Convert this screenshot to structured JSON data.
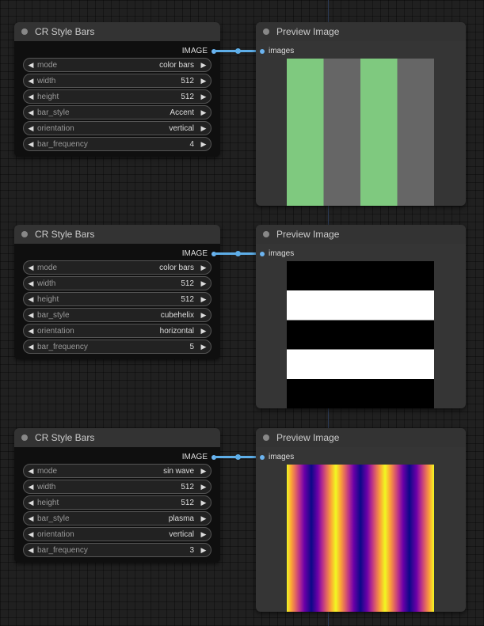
{
  "nodes": [
    {
      "title": "CR Style Bars",
      "output_label": "IMAGE",
      "widgets": [
        {
          "label": "mode",
          "value": "color bars"
        },
        {
          "label": "width",
          "value": "512"
        },
        {
          "label": "height",
          "value": "512"
        },
        {
          "label": "bar_style",
          "value": "Accent"
        },
        {
          "label": "orientation",
          "value": "vertical"
        },
        {
          "label": "bar_frequency",
          "value": "4"
        }
      ],
      "preview_title": "Preview Image",
      "input_label": "images"
    },
    {
      "title": "CR Style Bars",
      "output_label": "IMAGE",
      "widgets": [
        {
          "label": "mode",
          "value": "color bars"
        },
        {
          "label": "width",
          "value": "512"
        },
        {
          "label": "height",
          "value": "512"
        },
        {
          "label": "bar_style",
          "value": "cubehelix"
        },
        {
          "label": "orientation",
          "value": "horizontal"
        },
        {
          "label": "bar_frequency",
          "value": "5"
        }
      ],
      "preview_title": "Preview Image",
      "input_label": "images"
    },
    {
      "title": "CR Style Bars",
      "output_label": "IMAGE",
      "widgets": [
        {
          "label": "mode",
          "value": "sin wave"
        },
        {
          "label": "width",
          "value": "512"
        },
        {
          "label": "height",
          "value": "512"
        },
        {
          "label": "bar_style",
          "value": "plasma"
        },
        {
          "label": "orientation",
          "value": "vertical"
        },
        {
          "label": "bar_frequency",
          "value": "3"
        }
      ],
      "preview_title": "Preview Image",
      "input_label": "images"
    }
  ],
  "colors": {
    "link": "#5eaee8",
    "accent_green": "#7fc97f",
    "accent_gray": "#666666"
  },
  "icons": {
    "arrow_left": "◀",
    "arrow_right": "▶"
  }
}
